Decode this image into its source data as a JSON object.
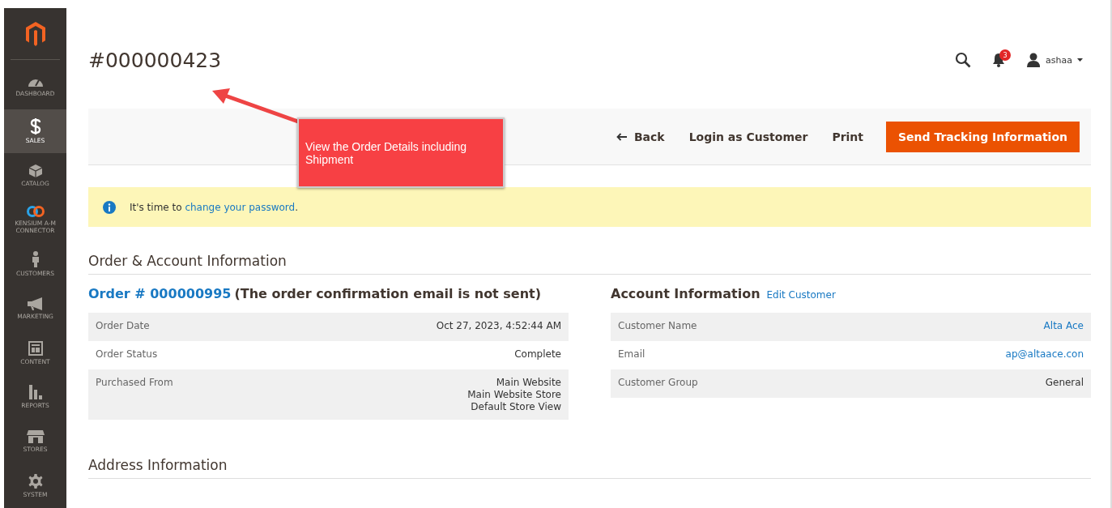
{
  "sidebar": {
    "items": [
      {
        "label": "DASHBOARD",
        "selected": false
      },
      {
        "label": "SALES",
        "selected": true
      },
      {
        "label": "CATALOG",
        "selected": false
      },
      {
        "label": "KENSIUM A-M CONNECTOR",
        "selected": false
      },
      {
        "label": "CUSTOMERS",
        "selected": false
      },
      {
        "label": "MARKETING",
        "selected": false
      },
      {
        "label": "CONTENT",
        "selected": false
      },
      {
        "label": "REPORTS",
        "selected": false
      },
      {
        "label": "STORES",
        "selected": false
      },
      {
        "label": "SYSTEM",
        "selected": false
      }
    ]
  },
  "page_title": "#000000423",
  "header": {
    "notification_count": "3",
    "user": "ashaa"
  },
  "actions": [
    {
      "label": "Back",
      "kind": "back"
    },
    {
      "label": "Login as Customer",
      "kind": "link"
    },
    {
      "label": "Print",
      "kind": "link"
    },
    {
      "label": "Send Tracking Information",
      "kind": "primary"
    }
  ],
  "message": {
    "before": "It's time to ",
    "link": "change your password",
    "after": "."
  },
  "callout": "View the Order Details including Shipment",
  "section_title": "Order & Account Information",
  "order": {
    "link": "Order # 000000995",
    "note": "(The order confirmation email is not sent)",
    "rows": [
      {
        "label": "Order Date",
        "values": [
          "Oct 27, 2023, 4:52:44 AM"
        ]
      },
      {
        "label": "Order Status",
        "values": [
          "Complete"
        ]
      },
      {
        "label": "Purchased From",
        "values": [
          "Main Website",
          "Main Website Store",
          "Default Store View"
        ]
      }
    ]
  },
  "account": {
    "title": "Account Information",
    "link": "Edit Customer",
    "rows": [
      {
        "label": "Customer Name",
        "values": [
          "Alta Ace"
        ],
        "kind": "link"
      },
      {
        "label": "Email",
        "values": [
          "ap@altaace.con"
        ],
        "kind": "link"
      },
      {
        "label": "Customer Group",
        "values": [
          "General"
        ],
        "kind": "text"
      }
    ]
  },
  "next_section_title": "Address Information"
}
